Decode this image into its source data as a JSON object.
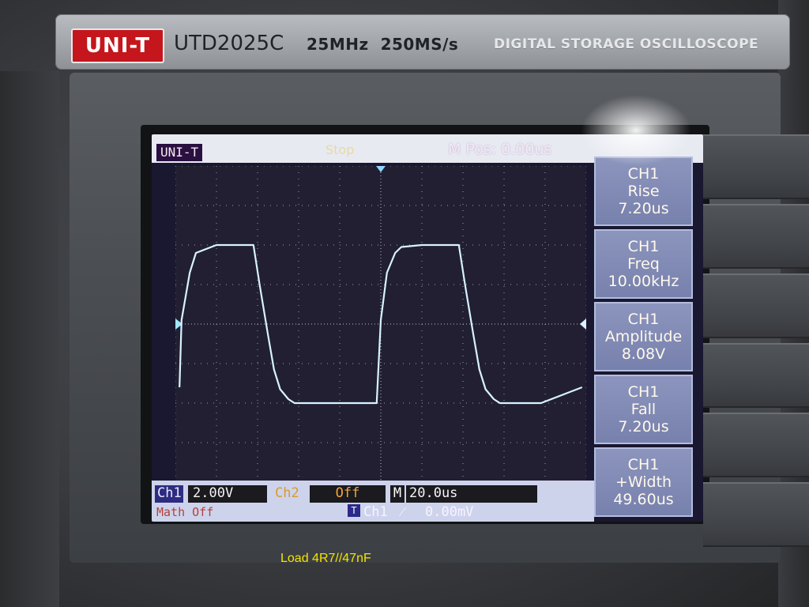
{
  "device": {
    "logo": "UNI-T",
    "model": "UTD2025C",
    "bandwidth": "25MHz",
    "sample_rate": "250MS/s",
    "description": "DIGITAL STORAGE OSCILLOSCOPE"
  },
  "screen": {
    "badge": "UNI-T",
    "run_state": "Stop",
    "m_pos": "M Pos: 0.00us",
    "menu": [
      {
        "title": "CH1",
        "name": "Rise",
        "value": "7.20us"
      },
      {
        "title": "CH1",
        "name": "Freq",
        "value": "10.00kHz"
      },
      {
        "title": "CH1",
        "name": "Amplitude",
        "value": "8.08V"
      },
      {
        "title": "CH1",
        "name": "Fall",
        "value": "7.20us"
      },
      {
        "title": "CH1",
        "name": "+Width",
        "value": "49.60us"
      }
    ],
    "bottom": {
      "ch1_label": "Ch1",
      "ch1_scale": "2.00V",
      "ch2_label": "Ch2",
      "ch2_state": "Off",
      "m_label": "M",
      "timebase": "20.0us",
      "math": "Math Off",
      "trigger_badge": "T",
      "trigger_source": "Ch1",
      "trigger_edge": "⁄",
      "trigger_level": "0.00mV"
    },
    "colors": {
      "trace": "#d8f3ff",
      "grid": "#c9c7d6",
      "menu_bg": "#7f89b4"
    }
  },
  "caption": "Load 4R7//47nF",
  "chart_data": {
    "type": "line",
    "x_unit": "us",
    "y_unit": "V",
    "xlim": [
      -100,
      100
    ],
    "ylim": [
      -8,
      8
    ],
    "x_div": 20.0,
    "y_div": 2.0,
    "grid": true,
    "series": [
      {
        "x": [
          -98,
          -97,
          -93,
          -90,
          -80,
          -70,
          -62,
          -59,
          -55,
          -52,
          -49,
          -45,
          -42,
          -40,
          -30,
          -22,
          -2,
          0,
          3,
          7,
          10,
          20,
          30,
          38,
          41,
          45,
          48,
          51,
          55,
          58,
          60,
          70,
          78,
          98
        ],
        "y": [
          -3.2,
          0.2,
          2.6,
          3.6,
          4.0,
          4.0,
          4.0,
          2.0,
          -0.5,
          -2.3,
          -3.3,
          -3.8,
          -4.0,
          -4.0,
          -4.0,
          -4.0,
          -4.0,
          0.2,
          2.6,
          3.6,
          3.9,
          4.0,
          4.0,
          4.0,
          2.0,
          -0.5,
          -2.3,
          -3.3,
          -3.8,
          -4.0,
          -4.0,
          -4.0,
          -4.0,
          -3.2
        ]
      }
    ]
  }
}
